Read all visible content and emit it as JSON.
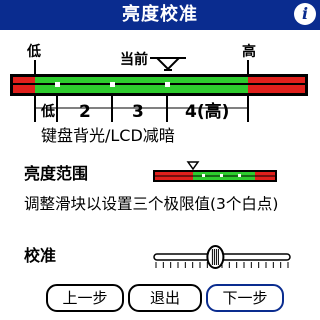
{
  "window": {
    "title": "亮度校准",
    "info_icon": "info-icon"
  },
  "diagram": {
    "low_label": "低",
    "current_label": "当前",
    "high_label": "高",
    "low_marker": "低",
    "segments": [
      "2",
      "3",
      "4(高)"
    ],
    "caption": "键盘背光/LCD减暗"
  },
  "range": {
    "heading": "亮度范围",
    "description": "调整滑块以设置三个极限值(3个白点)"
  },
  "calibrate": {
    "heading": "校准",
    "slider_level": 0.45
  },
  "buttons": {
    "prev": "上一步",
    "exit": "退出",
    "next": "下一步"
  },
  "colors": {
    "title_bar": "#0a2c8f",
    "red": "#e0201c",
    "green": "#2ecc2e",
    "white": "#ffffff"
  }
}
